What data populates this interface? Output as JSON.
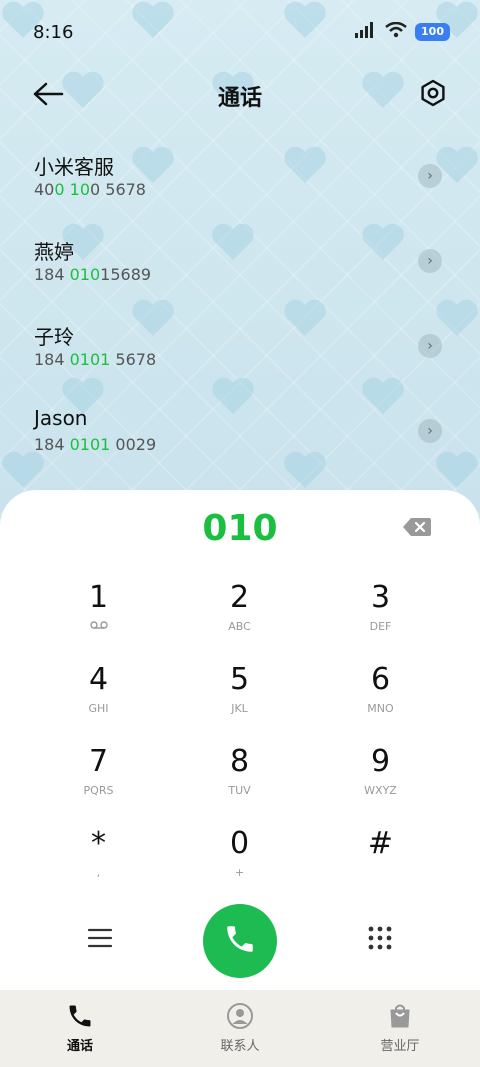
{
  "status": {
    "time": "8:16",
    "battery": "100"
  },
  "header": {
    "title": "通话"
  },
  "contacts": [
    {
      "name": "小米客服",
      "num_pre": "40",
      "num_hl1": "0",
      "num_mid": " ",
      "num_hl2": "10",
      "num_post": "0 5678"
    },
    {
      "name": "燕婷",
      "num_pre": "184 ",
      "num_hl1": "010",
      "num_mid": "",
      "num_hl2": "",
      "num_post": "15689"
    },
    {
      "name": "子玲",
      "num_pre": "184 ",
      "num_hl1": "0101",
      "num_mid": "",
      "num_hl2": "",
      "num_post": " 5678"
    },
    {
      "name": "Jason",
      "num_pre": "184 ",
      "num_hl1": "0101",
      "num_mid": "",
      "num_hl2": "",
      "num_post": " 0029"
    }
  ],
  "dialer": {
    "display": "010"
  },
  "keypad": [
    {
      "digit": "1",
      "sub": ""
    },
    {
      "digit": "2",
      "sub": "ABC"
    },
    {
      "digit": "3",
      "sub": "DEF"
    },
    {
      "digit": "4",
      "sub": "GHI"
    },
    {
      "digit": "5",
      "sub": "JKL"
    },
    {
      "digit": "6",
      "sub": "MNO"
    },
    {
      "digit": "7",
      "sub": "PQRS"
    },
    {
      "digit": "8",
      "sub": "TUV"
    },
    {
      "digit": "9",
      "sub": "WXYZ"
    },
    {
      "digit": "*",
      "sub": ","
    },
    {
      "digit": "0",
      "sub": "+"
    },
    {
      "digit": "#",
      "sub": ""
    }
  ],
  "nav": [
    {
      "label": "通话",
      "icon": "phone-icon"
    },
    {
      "label": "联系人",
      "icon": "contacts-icon"
    },
    {
      "label": "营业厅",
      "icon": "store-bag-icon"
    }
  ],
  "colors": {
    "accent": "#1bbf3f",
    "call": "#1dbb52",
    "battery": "#3a7ff2"
  }
}
